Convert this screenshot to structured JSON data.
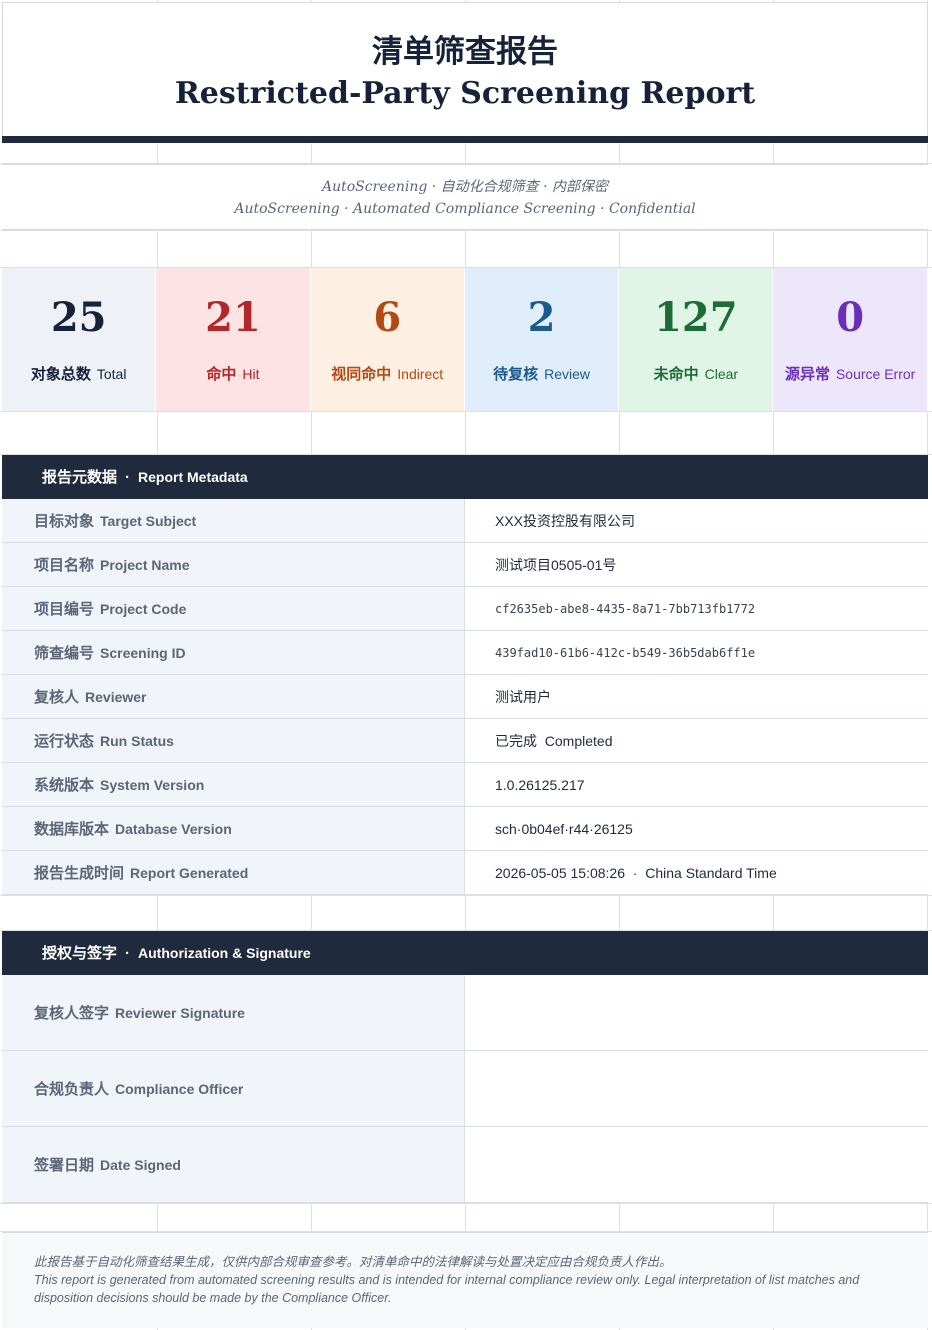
{
  "title": {
    "cn": "清单筛查报告",
    "en": "Restricted-Party Screening Report"
  },
  "subtitle": {
    "line_cn": "AutoScreening · 自动化合规筛查 · 内部保密",
    "line_en": "AutoScreening · Automated Compliance Screening · Confidential"
  },
  "kpis": [
    {
      "value": "25",
      "label_cn": "对象总数",
      "label_en": "Total",
      "color": "#16213a",
      "bg": "#eef2f7"
    },
    {
      "value": "21",
      "label_cn": "命中",
      "label_en": "Hit",
      "color": "#b3262a",
      "bg": "#fde3e3"
    },
    {
      "value": "6",
      "label_cn": "视同命中",
      "label_en": "Indirect",
      "color": "#b34a16",
      "bg": "#fdf0e3"
    },
    {
      "value": "2",
      "label_cn": "待复核",
      "label_en": "Review",
      "color": "#1d5a8c",
      "bg": "#e0edfa"
    },
    {
      "value": "127",
      "label_cn": "未命中",
      "label_en": "Clear",
      "color": "#1d6b35",
      "bg": "#e0f5e6"
    },
    {
      "value": "0",
      "label_cn": "源异常",
      "label_en": "Source Error",
      "color": "#6a2fb8",
      "bg": "#ede7fb"
    }
  ],
  "metadata": {
    "header_cn": "报告元数据",
    "header_sep": "·",
    "header_en": "Report Metadata",
    "rows": [
      {
        "key_cn": "目标对象",
        "key_en": "Target Subject",
        "value": "XXX投资控股有限公司"
      },
      {
        "key_cn": "项目名称",
        "key_en": "Project Name",
        "value": "测试项目0505-01号"
      },
      {
        "key_cn": "项目编号",
        "key_en": "Project Code",
        "value": "cf2635eb-abe8-4435-8a71-7bb713fb1772"
      },
      {
        "key_cn": "筛查编号",
        "key_en": "Screening ID",
        "value": "439fad10-61b6-412c-b549-36b5dab6ff1e"
      },
      {
        "key_cn": "复核人",
        "key_en": "Reviewer",
        "value": "测试用户"
      },
      {
        "key_cn": "运行状态",
        "key_en": "Run Status",
        "value": "已完成  Completed"
      },
      {
        "key_cn": "系统版本",
        "key_en": "System Version",
        "value": "1.0.26125.217"
      },
      {
        "key_cn": "数据库版本",
        "key_en": "Database Version",
        "value": "sch·0b04ef·r44·26125"
      },
      {
        "key_cn": "报告生成时间",
        "key_en": "Report Generated",
        "value": "2026-05-05 15:08:26  ·  China Standard Time"
      }
    ]
  },
  "signature": {
    "header_cn": "授权与签字",
    "header_sep": "·",
    "header_en": "Authorization & Signature",
    "rows": [
      {
        "key_cn": "复核人签字",
        "key_en": "Reviewer Signature",
        "value": ""
      },
      {
        "key_cn": "合规负责人",
        "key_en": "Compliance Officer",
        "value": ""
      },
      {
        "key_cn": "签署日期",
        "key_en": "Date Signed",
        "value": ""
      }
    ]
  },
  "footer": {
    "cn": "此报告基于自动化筛查结果生成，仅供内部合规审查参考。对清单命中的法律解读与处置决定应由合规负责人作出。",
    "en": "This report is generated from automated screening results and is intended for internal compliance review only. Legal interpretation of list matches and disposition decisions should be made by the Compliance Officer."
  }
}
